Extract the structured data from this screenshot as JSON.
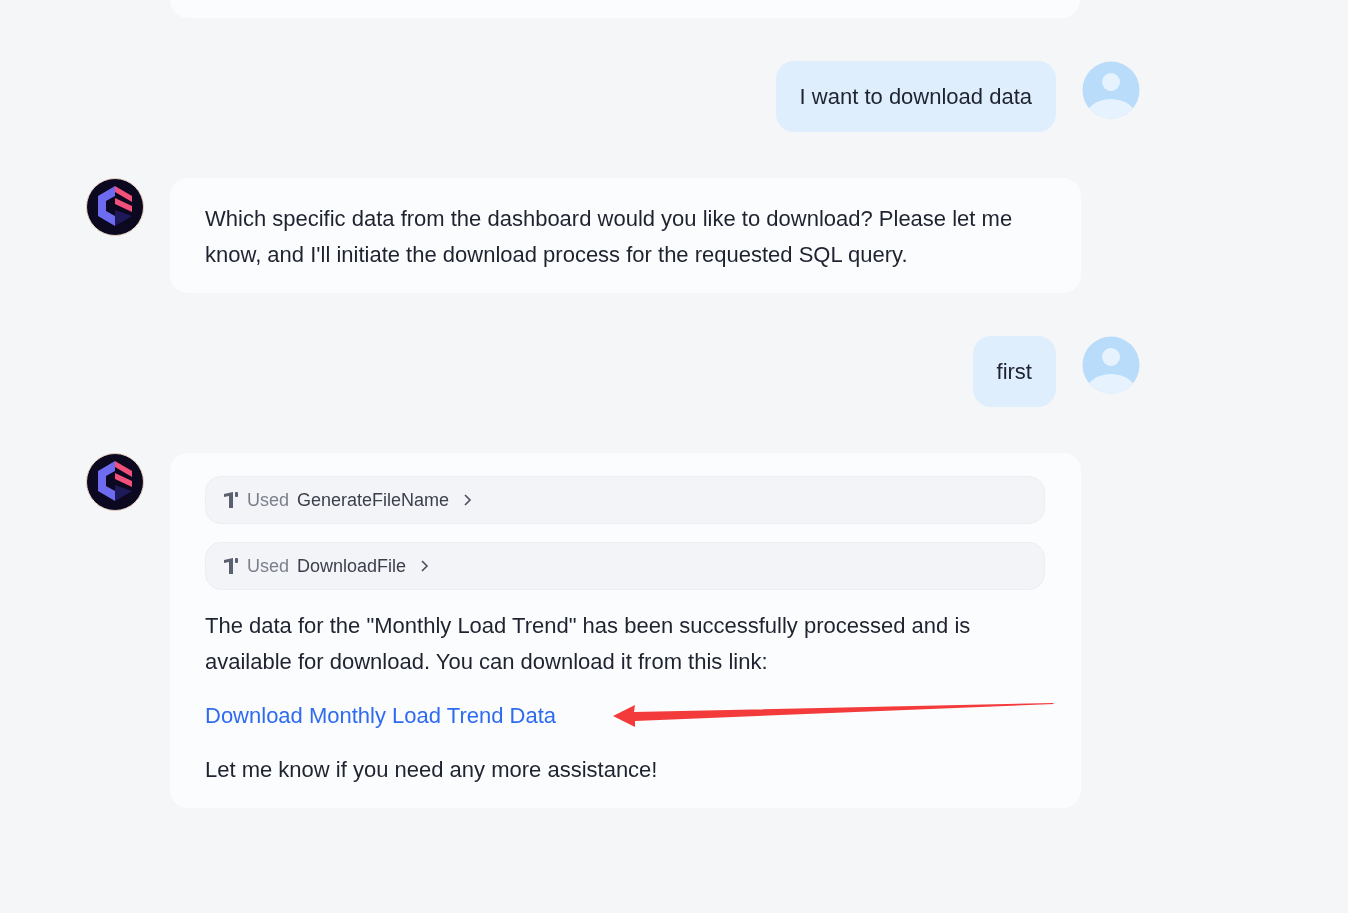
{
  "messages": [
    {
      "kind": "user",
      "text": "I want to download data"
    },
    {
      "kind": "bot",
      "blocks": [
        {
          "kind": "text",
          "text": "Which specific data from the dashboard would you like to download? Please let me know, and I'll initiate the download process for the requested SQL query."
        }
      ]
    },
    {
      "kind": "user",
      "text": "first"
    },
    {
      "kind": "bot",
      "blocks": [
        {
          "kind": "tool",
          "verb": "Used",
          "name": "GenerateFileName"
        },
        {
          "kind": "tool",
          "verb": "Used",
          "name": "DownloadFile"
        },
        {
          "kind": "text",
          "text": "The data for the \"Monthly Load Trend\" has been successfully processed and is available for download. You can download it from this link:"
        },
        {
          "kind": "link",
          "text": "Download Monthly Load Trend Data"
        },
        {
          "kind": "text",
          "text": "Let me know if you need any more assistance!"
        }
      ]
    }
  ]
}
